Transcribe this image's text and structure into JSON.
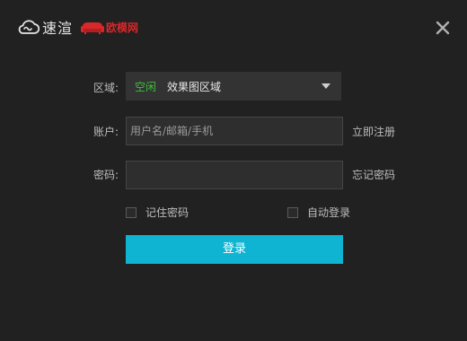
{
  "header": {
    "brand_name": "速渲",
    "partner_name": "欧模网",
    "icons": [
      "cloud-icon",
      "sofa-icon",
      "close-icon"
    ]
  },
  "form": {
    "region": {
      "label": "区域:",
      "status": "空闲",
      "value": "效果图区域"
    },
    "account": {
      "label": "账户:",
      "placeholder": "用户名/邮箱/手机",
      "value": "",
      "side_link": "立即注册"
    },
    "password": {
      "label": "密码:",
      "placeholder": "",
      "value": "",
      "side_link": "忘记密码"
    },
    "remember_password": {
      "label": "记住密码",
      "checked": false
    },
    "auto_login": {
      "label": "自动登录",
      "checked": false
    },
    "submit_label": "登录"
  },
  "colors": {
    "background": "#212121",
    "accent": "#0eb4d2",
    "status_free": "#3fbf3f",
    "partner_red": "#d7282b"
  }
}
